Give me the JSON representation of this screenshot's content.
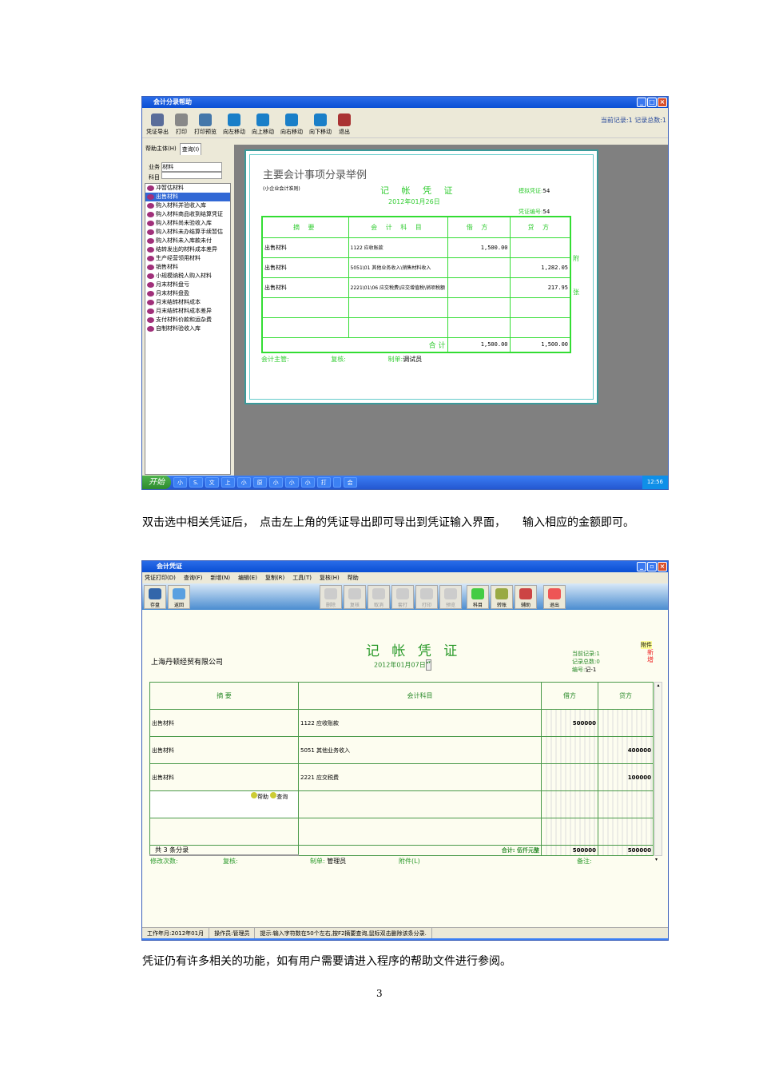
{
  "screenshot1": {
    "title": "会计分录帮助",
    "toolbar": [
      "凭证导出",
      "打印",
      "打印预览",
      "向左移动",
      "向上移动",
      "向右移动",
      "向下移动",
      "退出"
    ],
    "record_status": "当前记录:1 记录总数:1",
    "tabs": [
      "帮助主体(H)",
      "查询(I)"
    ],
    "business_label": "业务",
    "business_value": "材料",
    "subject_label": "科目",
    "subject_value": "",
    "list": [
      "冲暂估材料",
      "出售材料",
      "购入材料并验收入库",
      "购入材料商品收到结算凭证",
      "购入材料尚未验收入库",
      "购入材料未办结算手续暂估",
      "购入材料未入库款未付",
      "结转发出的材料成本差异",
      "生产经营领用材料",
      "销售材料",
      "小规模纳税人购入材料",
      "月末材料盘亏",
      "月末材料盘盈",
      "月末结转材料成本",
      "月末结转材料成本差异",
      "支付材料价款和运杂费",
      "自制材料验收入库"
    ],
    "selected_index": 1,
    "doc": {
      "heading": "主要会计事项分录举例",
      "subheading": "(小企业会计准则)",
      "voucher_title": "记 帐 凭 证",
      "date": "2012年01月26日",
      "sim_label": "模拟凭证:",
      "sim_value": "54",
      "no_label": "凭证编号:",
      "no_value": "54",
      "headers": [
        "摘 要",
        "会 计 科 目",
        "借 方",
        "贷 方"
      ],
      "rows": [
        [
          "出售材料",
          "1122 应收账款",
          "1,500.00",
          ""
        ],
        [
          "出售材料",
          "5051\\01 其他业务收入\\销售材料收入",
          "",
          "1,282.05"
        ],
        [
          "出售材料",
          "2221\\01\\06 应交税费\\应交增值税\\销项税额",
          "",
          "217.95"
        ],
        [
          "",
          "",
          "",
          ""
        ],
        [
          "",
          "",
          "",
          ""
        ]
      ],
      "total_label": "合 计",
      "total_debit": "1,500.00",
      "total_credit": "1,500.00",
      "side1": "附",
      "side2": "张",
      "f_supervisor": "会计主管:",
      "f_review": "复核:",
      "f_maker": "制单:",
      "f_maker_value": "调试员"
    },
    "taskbar": {
      "start": "开始",
      "items": [
        "小",
        "S.",
        "文",
        "上",
        "小",
        "原",
        "小",
        "小",
        "小",
        "打",
        "",
        "会"
      ],
      "clock": "12:56"
    }
  },
  "paragraph1": "双击选中相关凭证后，　点击左上角的凭证导出即可导出到凭证输入界面，　　输入相应的金额即可。",
  "screenshot2": {
    "title": "会计凭证",
    "menu": [
      "凭证打印(D)",
      "查询(F)",
      "新增(N)",
      "编辑(E)",
      "复制(R)",
      "工具(T)",
      "复核(H)",
      "帮助"
    ],
    "toolbar_left": [
      "存盘",
      "返回"
    ],
    "toolbar_disabled": [
      "删除",
      "复核",
      "取消",
      "套打",
      "打印",
      "预览"
    ],
    "toolbar_right": [
      "科目",
      "转账",
      "辅助"
    ],
    "exit": "退出",
    "company": "上海丹顿经贸有限公司",
    "voucher_title": "记 帐 凭 证",
    "date": "2012年01月07日",
    "current_record": "当前记录:1",
    "total_records": "记录总数:0",
    "number_label": "编号:",
    "number_value": "记-1",
    "attach_badge": "附件",
    "new_badge": "新增",
    "headers": [
      "摘 要",
      "会计科目",
      "借方",
      "贷方"
    ],
    "rows": [
      [
        "出售材料",
        "1122 应收账款",
        "500000",
        ""
      ],
      [
        "出售材料",
        "5051 其他业务收入",
        "",
        "400000"
      ],
      [
        "出售材料",
        "2221 应交税费",
        "",
        "100000"
      ],
      [
        "",
        "",
        "",
        ""
      ],
      [
        "",
        "",
        "",
        ""
      ]
    ],
    "help_btn": "帮助",
    "query_btn": "查询",
    "entry_count": "共 3 条分录",
    "total_label": "合计: 伍仟元整",
    "total_debit": "500000",
    "total_credit": "500000",
    "f_changes": "修改次数:",
    "f_review": "复核:",
    "f_maker": "制单:",
    "f_maker_value": "管理员",
    "f_attach": "附件(L)",
    "f_note": "备注:",
    "status": [
      "工作年月:2012年01月",
      "操作员:管理员",
      "提示:输入字符数在50个左右,按F2摘要查询,鼠标双击删除该条分录."
    ]
  },
  "paragraph2": "凭证仍有许多相关的功能，如有用户需要请进入程序的帮助文件进行参阅。",
  "page_number": "3"
}
